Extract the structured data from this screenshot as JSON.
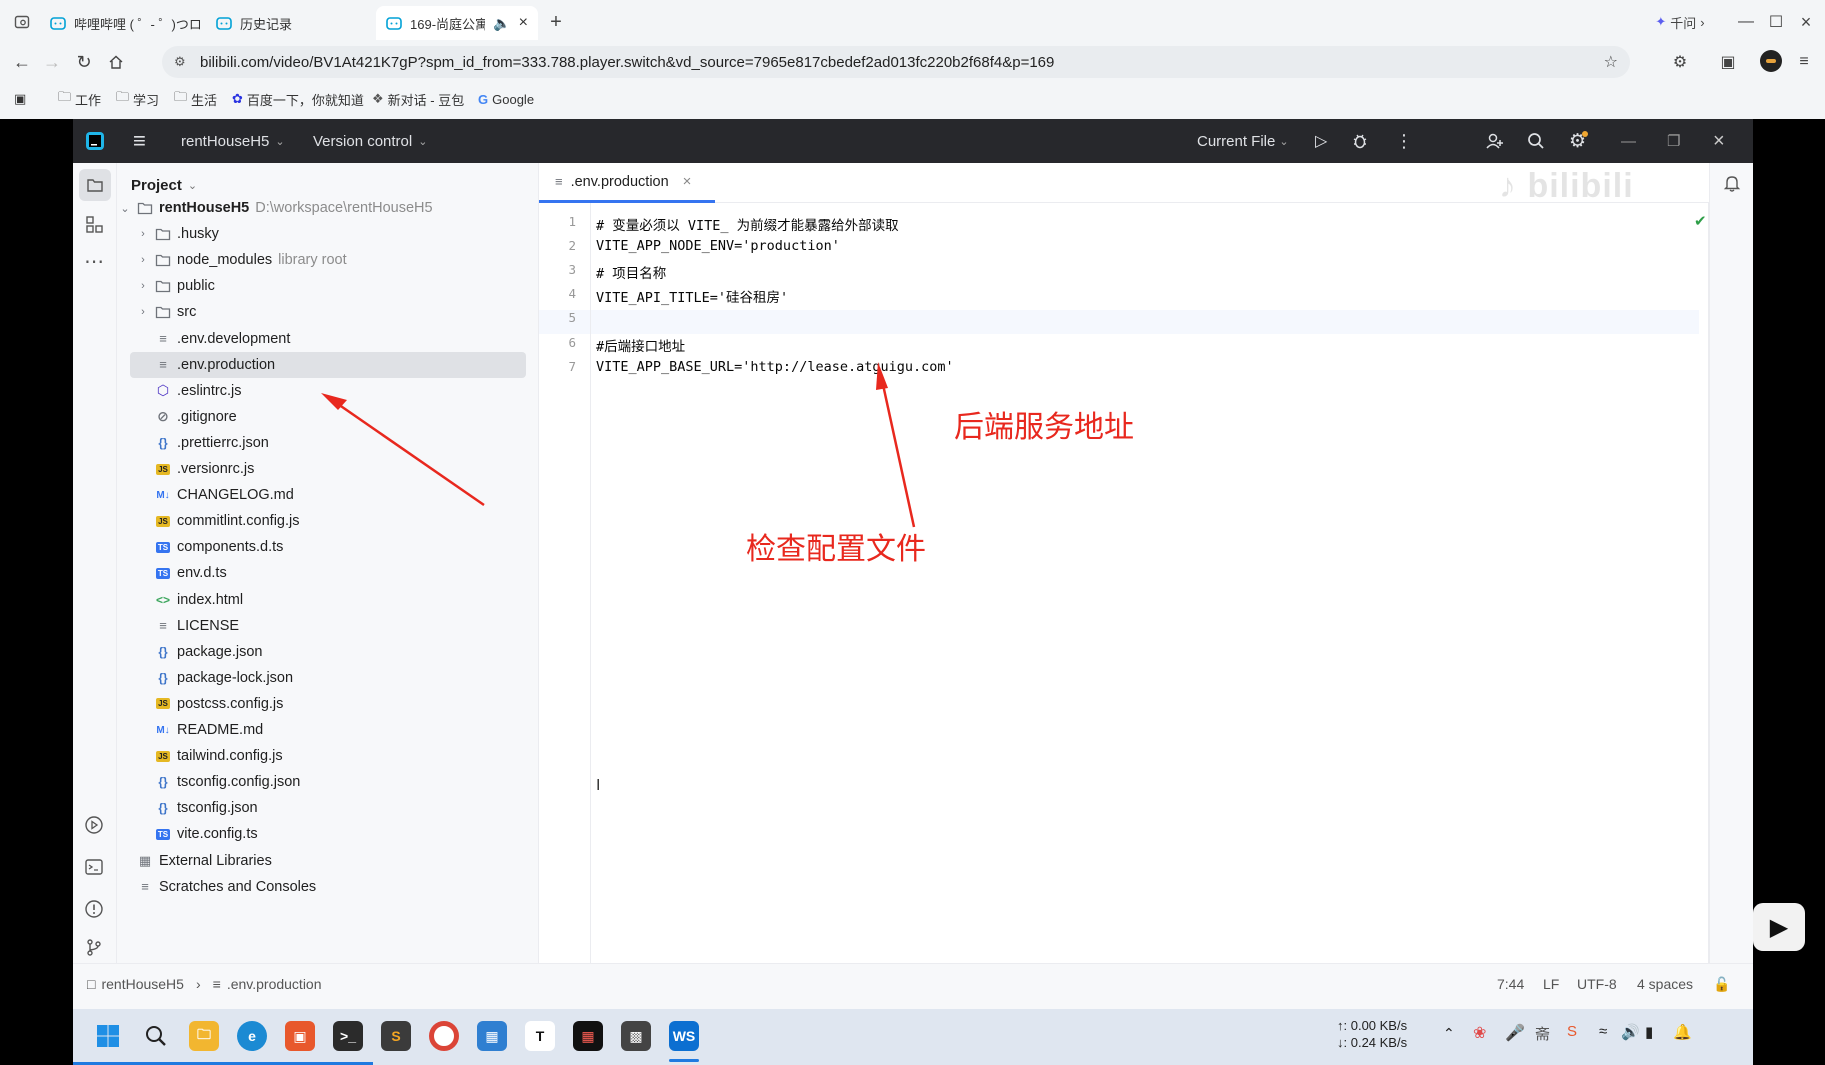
{
  "browser": {
    "tabs": [
      {
        "label": "哔哩哔哩 ( ゜- ゜)つロ"
      },
      {
        "label": "历史记录"
      },
      {
        "label": "169-尚庭公寓"
      }
    ],
    "url": "bilibili.com/video/BV1At421K7gP?spm_id_from=333.788.player.switch&vd_source=7965e817cbedef2ad013fc220b2f68f4&p=169",
    "qianwen_label": "千问",
    "bookmarks": [
      "工作",
      "学习",
      "生活",
      "百度一下，你就知道",
      "新对话 - 豆包",
      "Google"
    ]
  },
  "ide": {
    "project_name": "rentHouseH5",
    "vcs_label": "Version control",
    "run_config": "Current File",
    "panel_title": "Project",
    "root_label": "rentHouseH5",
    "root_path": "D:\\workspace\\rentHouseH5",
    "tree": [
      {
        "label": ".husky",
        "kind": "folder",
        "hint": ""
      },
      {
        "label": "node_modules",
        "kind": "folder",
        "hint": "library root"
      },
      {
        "label": "public",
        "kind": "folder",
        "hint": ""
      },
      {
        "label": "src",
        "kind": "folder",
        "hint": ""
      },
      {
        "label": ".env.development",
        "kind": "text",
        "hint": ""
      },
      {
        "label": ".env.production",
        "kind": "text",
        "hint": ""
      },
      {
        "label": ".eslintrc.js",
        "kind": "eslint",
        "hint": ""
      },
      {
        "label": ".gitignore",
        "kind": "ignore",
        "hint": ""
      },
      {
        "label": ".prettierrc.json",
        "kind": "json",
        "hint": ""
      },
      {
        "label": ".versionrc.js",
        "kind": "js",
        "hint": ""
      },
      {
        "label": "CHANGELOG.md",
        "kind": "md",
        "hint": ""
      },
      {
        "label": "commitlint.config.js",
        "kind": "js",
        "hint": ""
      },
      {
        "label": "components.d.ts",
        "kind": "ts",
        "hint": ""
      },
      {
        "label": "env.d.ts",
        "kind": "ts",
        "hint": ""
      },
      {
        "label": "index.html",
        "kind": "html",
        "hint": ""
      },
      {
        "label": "LICENSE",
        "kind": "text",
        "hint": ""
      },
      {
        "label": "package.json",
        "kind": "json",
        "hint": ""
      },
      {
        "label": "package-lock.json",
        "kind": "json",
        "hint": ""
      },
      {
        "label": "postcss.config.js",
        "kind": "js",
        "hint": ""
      },
      {
        "label": "README.md",
        "kind": "md",
        "hint": ""
      },
      {
        "label": "tailwind.config.js",
        "kind": "js",
        "hint": ""
      },
      {
        "label": "tsconfig.config.json",
        "kind": "json",
        "hint": ""
      },
      {
        "label": "tsconfig.json",
        "kind": "json",
        "hint": ""
      },
      {
        "label": "vite.config.ts",
        "kind": "ts",
        "hint": ""
      }
    ],
    "external_libraries": "External Libraries",
    "scratches": "Scratches and Consoles",
    "editor_tab": ".env.production",
    "code_lines": [
      "# 变量必须以 VITE_ 为前缀才能暴露给外部读取",
      "VITE_APP_NODE_ENV='production'",
      "# 项目名称",
      "VITE_API_TITLE='硅谷租房'",
      "",
      "#后端接口地址",
      "VITE_APP_BASE_URL='http://lease.atguigu.com'"
    ],
    "status": {
      "breadcrumb_project": "rentHouseH5",
      "breadcrumb_file": ".env.production",
      "position": "7:44",
      "line_sep": "LF",
      "encoding": "UTF-8",
      "indent": "4 spaces"
    }
  },
  "annotations": {
    "backend_address": "后端服务地址",
    "check_config": "检查配置文件"
  },
  "taskbar": {
    "net_up": "↑: 0.00 KB/s",
    "net_down": "↓: 0.24 KB/s"
  },
  "colors": {
    "accent_blue": "#3574f0",
    "annotation_red": "#e8281e",
    "ide_titlebar": "#27282c"
  }
}
